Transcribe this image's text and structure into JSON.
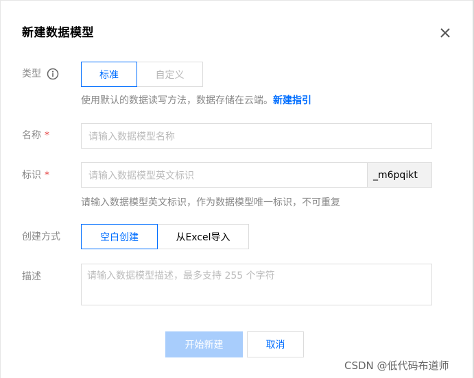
{
  "dialog": {
    "title": "新建数据模型",
    "close_icon": "close-icon"
  },
  "type_field": {
    "label": "类型",
    "info_icon": "info-circle-icon",
    "options": [
      "标准",
      "自定义"
    ],
    "selected": "标准",
    "hint": "使用默认的数据读写方法，数据存储在云端。",
    "hint_link": "新建指引"
  },
  "name_field": {
    "label": "名称",
    "required_mark": "*",
    "placeholder": "请输入数据模型名称"
  },
  "identifier_field": {
    "label": "标识",
    "required_mark": "*",
    "placeholder": "请输入数据模型英文标识",
    "suffix": "_m6pqikt",
    "hint": "请输入数据模型英文标识，作为数据模型唯一标识，不可重复"
  },
  "create_method_field": {
    "label": "创建方式",
    "options": [
      "空白创建",
      "从Excel导入"
    ],
    "selected": "空白创建"
  },
  "description_field": {
    "label": "描述",
    "placeholder": "请输入数据模型描述，最多支持 255 个字符"
  },
  "footer": {
    "submit_label": "开始新建",
    "cancel_label": "取消"
  },
  "watermark": "CSDN @低代码布道师",
  "colors": {
    "accent": "#006eff",
    "accent_disabled": "#a8cdfc",
    "required": "#e54545",
    "label": "#888888",
    "border": "#dcdcdc"
  }
}
